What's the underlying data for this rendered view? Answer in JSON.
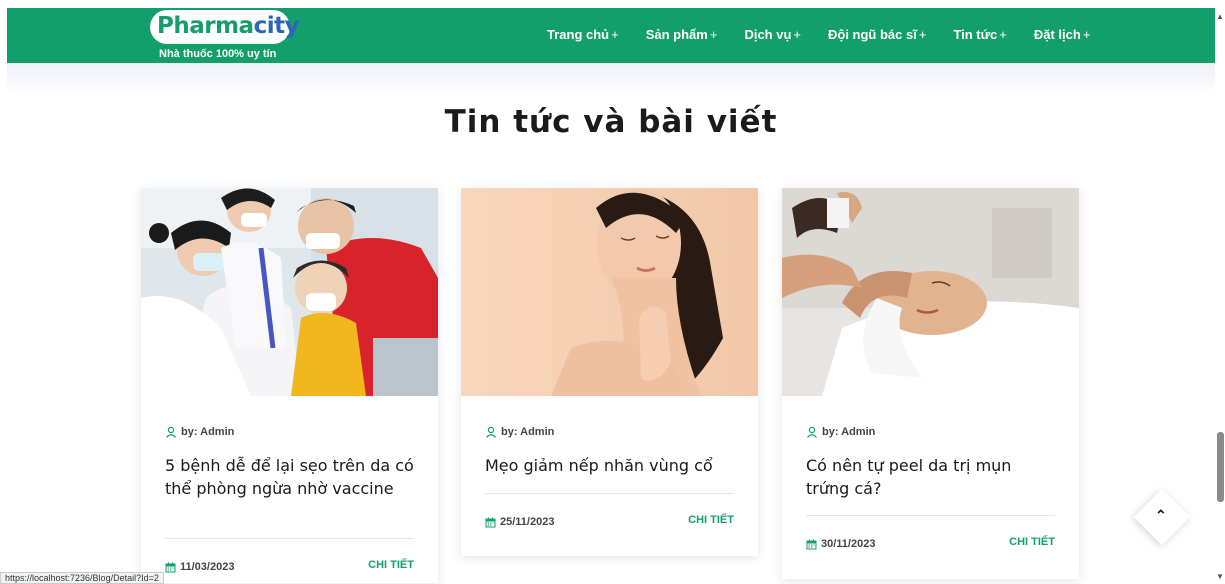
{
  "header": {
    "logo": {
      "brand_part1": "Pharma",
      "brand_part2": "city",
      "tagline": "Nhà thuốc 100% uy tín"
    },
    "nav": [
      {
        "label": "Trang chủ",
        "suffix": "+"
      },
      {
        "label": "Sản phẩm",
        "suffix": "+"
      },
      {
        "label": "Dịch vụ",
        "suffix": "+"
      },
      {
        "label": "Đội ngũ bác sĩ",
        "suffix": "+"
      },
      {
        "label": "Tin tức",
        "suffix": "+"
      },
      {
        "label": "Đặt lịch",
        "suffix": "+"
      }
    ]
  },
  "main": {
    "title": "Tin tức và bài viết",
    "posts": [
      {
        "author": "by: Admin",
        "title": "5 bệnh dễ để lại sẹo trên da có thể phòng ngừa nhờ vaccine",
        "date": "11/03/2023",
        "detail": "CHI TIẾT",
        "image": "vaccination-photo"
      },
      {
        "author": "by: Admin",
        "title": "Mẹo giảm nếp nhăn vùng cổ",
        "date": "25/11/2023",
        "detail": "CHI TIẾT",
        "image": "neck-skincare-photo"
      },
      {
        "author": "by: Admin",
        "title": "Có nên tự peel da trị mụn trứng cá?",
        "date": "30/11/2023",
        "detail": "CHI TIẾT",
        "image": "facial-treatment-photo"
      }
    ]
  },
  "status_bar": {
    "url": "https://localhost:7236/Blog/Detail?Id=2"
  },
  "icons": {
    "author": "user-icon",
    "date": "calendar-icon",
    "back_to_top": "chevron-up-icon"
  },
  "colors": {
    "brand_green": "#139f6c",
    "brand_blue": "#2c65b8",
    "text_dark": "#1a1a1a"
  }
}
